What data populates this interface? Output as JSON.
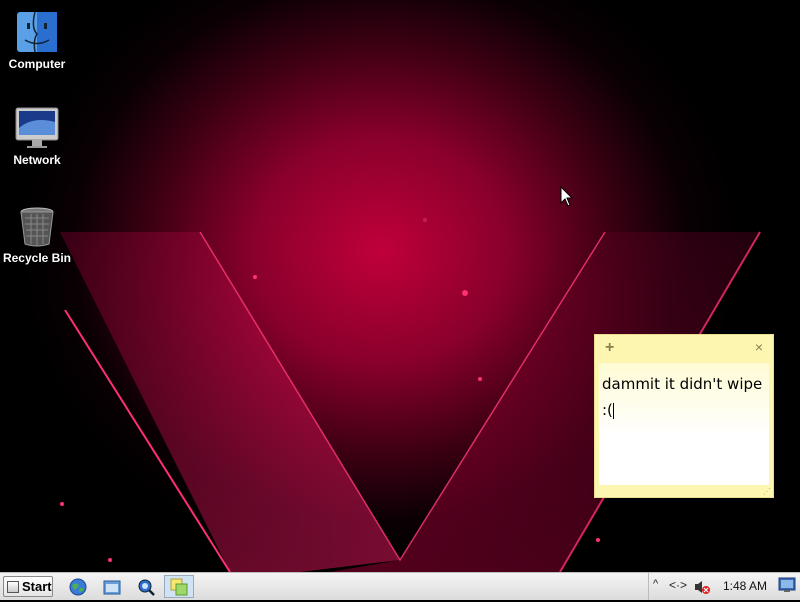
{
  "desktop": {
    "icons": [
      {
        "label": "Computer",
        "icon": "finder-face-icon"
      },
      {
        "label": "Network",
        "icon": "imac-monitor-icon"
      },
      {
        "label": "Recycle Bin",
        "icon": "trash-can-icon"
      }
    ]
  },
  "sticky_note": {
    "text_line1": "dammit it didn't wipe",
    "text_line2": ":(",
    "add_label": "+",
    "close_label": "×"
  },
  "taskbar": {
    "start_label": "Start",
    "quick_launch": [
      "globe-icon",
      "folder-icon",
      "search-icon"
    ],
    "active_app": "sticky-notes-icon"
  },
  "tray": {
    "chevron": "^",
    "network": "<·>",
    "clock": "1:48 AM"
  },
  "colors": {
    "wallpaper_accent": "#d8004a",
    "sticky_bg": "#fdf6b0",
    "taskbar_bg": "#e6e6e6"
  }
}
